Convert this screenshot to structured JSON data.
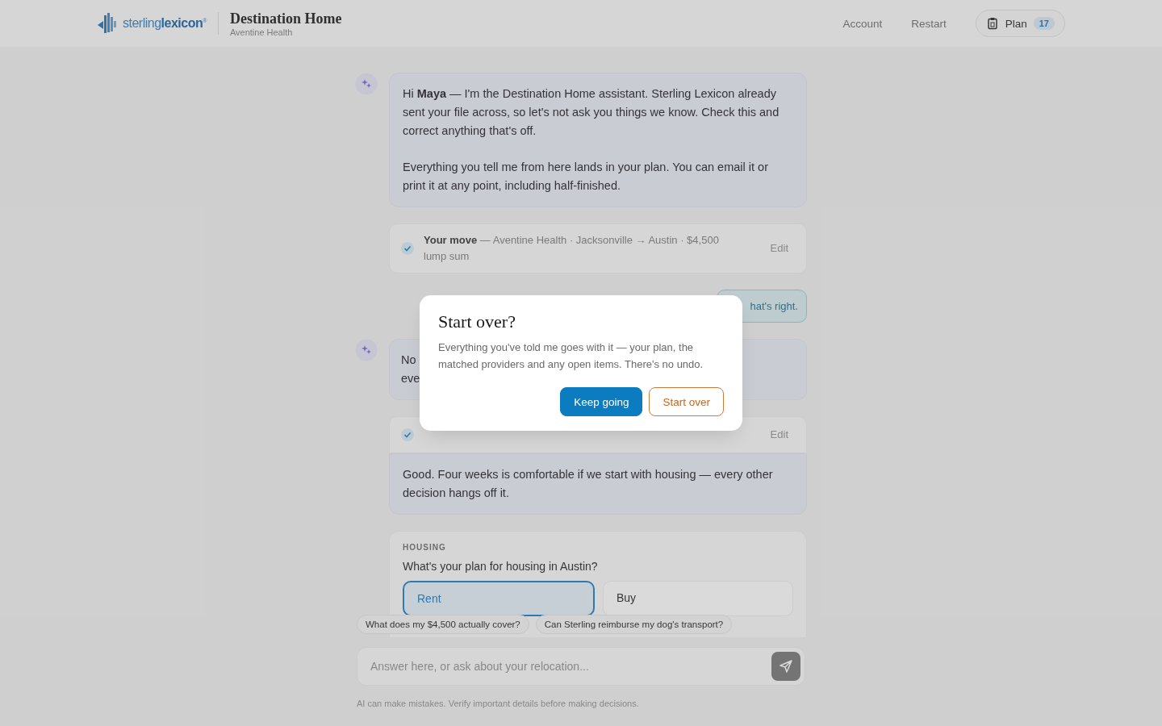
{
  "header": {
    "logo": "sterling**lexicon**$^{®}$",
    "title": "Destination Home",
    "subtitle": "Aventine Health",
    "nav": [
      "Account",
      "Restart"
    ],
    "plan": {
      "label": "Plan",
      "count": "17"
    }
  },
  "messages": [
    {
      "kind": "assistant",
      "paragraphs": [
        "Hi **Maya** — I'm the Destination Home assistant. Sterling Lexicon already sent your file across, so let's not ask you things we know. Check this and correct anything that's off.",
        "Everything you tell me from here lands in your plan. You can email it or print it at any point, including half-finished."
      ]
    },
    {
      "kind": "confirm",
      "text": "**Your move** — Aventine Health · Jacksonville → Austin · $4,500 lump sum",
      "checked": true,
      "action": "Edit"
    },
    {
      "kind": "user",
      "text": "hat's right."
    },
    {
      "kind": "assistant_cut",
      "lines": [
        "No",
        "eve"
      ]
    },
    {
      "kind": "confirm_joined",
      "checked": true,
      "action": "Edit",
      "reply": "Good. Four weeks is comfortable if we start with housing — every other decision hangs off it."
    },
    {
      "kind": "question",
      "label": "HOUSING",
      "question": "What's your plan for housing in Austin?",
      "options": [
        {
          "label": "Rent",
          "selected": true
        },
        {
          "label": "Buy",
          "selected": false
        }
      ]
    }
  ],
  "suggestions": [
    "What does my $4,500 actually cover?",
    "Can Sterling reimburse my dog's transport?"
  ],
  "composer": {
    "placeholder": "Answer here, or ask about your relocation..."
  },
  "disclaimer": "AI can make mistakes. Verify important details before making decisions.",
  "dialog": {
    "title": "Start over?",
    "body": "Everything you've told me goes with it — your plan, the matched providers and any open items. There's no undo.",
    "buttons": [
      {
        "label": "Keep going",
        "kind": "primary"
      },
      {
        "label": "Start over",
        "kind": "secondary"
      }
    ]
  }
}
